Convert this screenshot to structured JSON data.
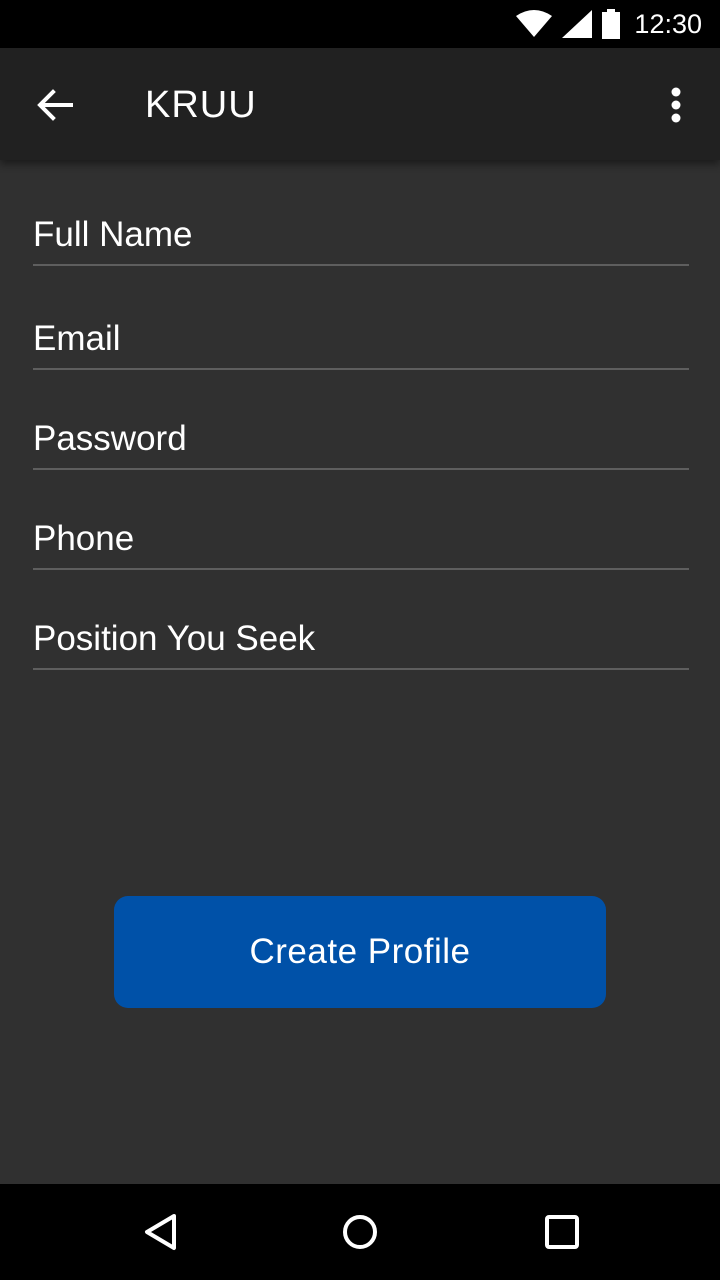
{
  "status_bar": {
    "time": "12:30",
    "icons": [
      "wifi-icon",
      "signal-icon",
      "battery-icon"
    ]
  },
  "app_bar": {
    "title": "KRUU",
    "back_icon": "arrow-left-icon",
    "overflow_icon": "more-vert-icon"
  },
  "form": {
    "full_name_placeholder": "Full Name",
    "email_placeholder": "Email",
    "password_placeholder": "Password",
    "phone_placeholder": "Phone",
    "position_placeholder": "Position You Seek"
  },
  "create_button_label": "Create Profile",
  "colors": {
    "background": "#303030",
    "app_bar": "#212121",
    "accent": "#0051a8",
    "divider": "#5e5e5e"
  },
  "nav_bar": {
    "icons": [
      "back-triangle-icon",
      "home-circle-icon",
      "recents-square-icon"
    ]
  }
}
